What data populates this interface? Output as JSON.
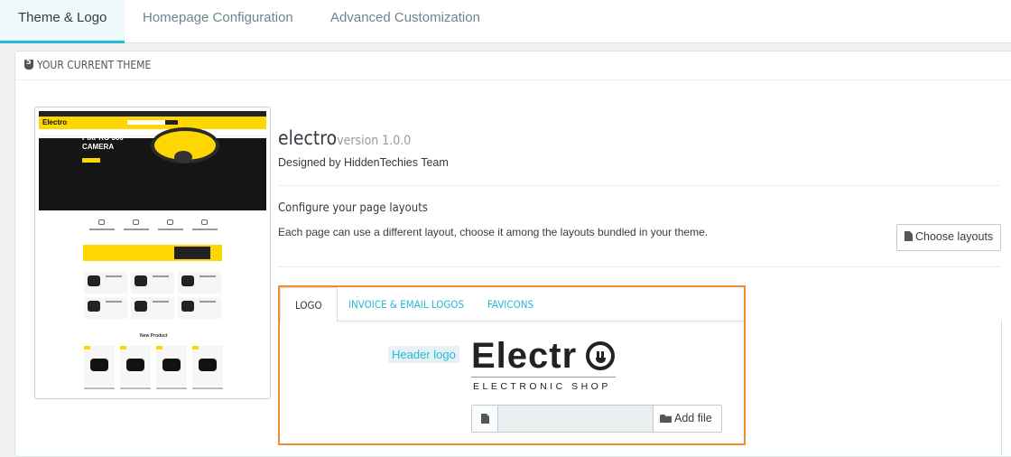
{
  "tabs": [
    {
      "label": "Theme & Logo",
      "active": true
    },
    {
      "label": "Homepage Configuration",
      "active": false
    },
    {
      "label": "Advanced Customization",
      "active": false
    }
  ],
  "panel": {
    "title": "YOUR CURRENT THEME",
    "icon": "html5-icon"
  },
  "theme": {
    "name": "electro",
    "version": "version 1.0.0",
    "designed_by": "Designed by HiddenTechies Team"
  },
  "preview_mock": {
    "logo": "Electro",
    "hero_title": "PIXPRO 360 CAMERA",
    "section_title": "New Product"
  },
  "layouts": {
    "title": "Configure your page layouts",
    "description": "Each page can use a different layout, choose it among the layouts bundled in your theme.",
    "button_label": "Choose layouts"
  },
  "logo_tabs": [
    {
      "label": "LOGO",
      "active": true
    },
    {
      "label": "INVOICE & EMAIL LOGOS",
      "active": false
    },
    {
      "label": "FAVICONS",
      "active": false
    }
  ],
  "logo_section": {
    "label": "Header logo",
    "logo_text": "Electr",
    "logo_subtext": "ELECTRONIC SHOP",
    "file_placeholder": "",
    "add_file_label": "Add file"
  },
  "colors": {
    "accent": "#25b9d7",
    "highlight": "#f08c31",
    "brand_yellow": "#fed700"
  }
}
